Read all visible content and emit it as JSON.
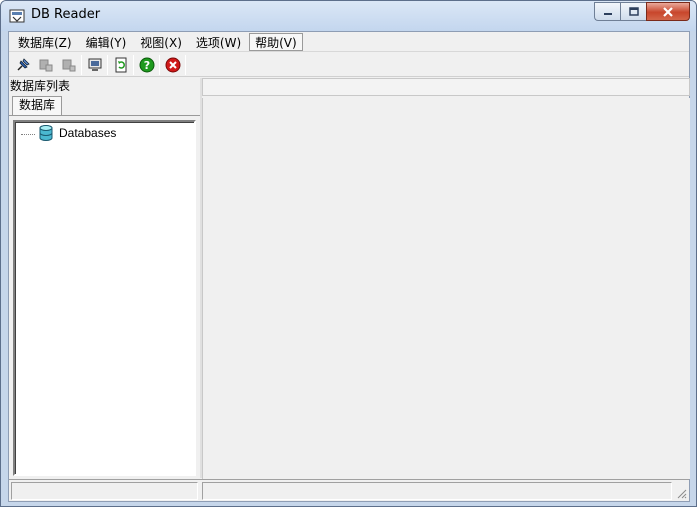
{
  "window": {
    "title": "DB Reader"
  },
  "menubar": {
    "items": [
      {
        "label": "数据库(Z)"
      },
      {
        "label": "编辑(Y)"
      },
      {
        "label": "视图(X)"
      },
      {
        "label": "选项(W)"
      },
      {
        "label": "帮助(V)"
      }
    ]
  },
  "toolbar": {
    "buttons": [
      {
        "icon": "pin-icon"
      },
      {
        "icon": "connect-db-icon"
      },
      {
        "icon": "disconnect-db-icon"
      },
      {
        "icon": "computer-icon"
      },
      {
        "icon": "refresh-icon"
      },
      {
        "icon": "help-icon"
      },
      {
        "icon": "stop-icon"
      }
    ]
  },
  "left_panel": {
    "caption": "数据库列表",
    "tab_label": "数据库",
    "tree": {
      "root_label": "Databases",
      "root_icon": "database-icon"
    }
  },
  "colors": {
    "close_button": "#c8462c",
    "help_green": "#1e9a1e",
    "stop_red": "#d01818"
  }
}
